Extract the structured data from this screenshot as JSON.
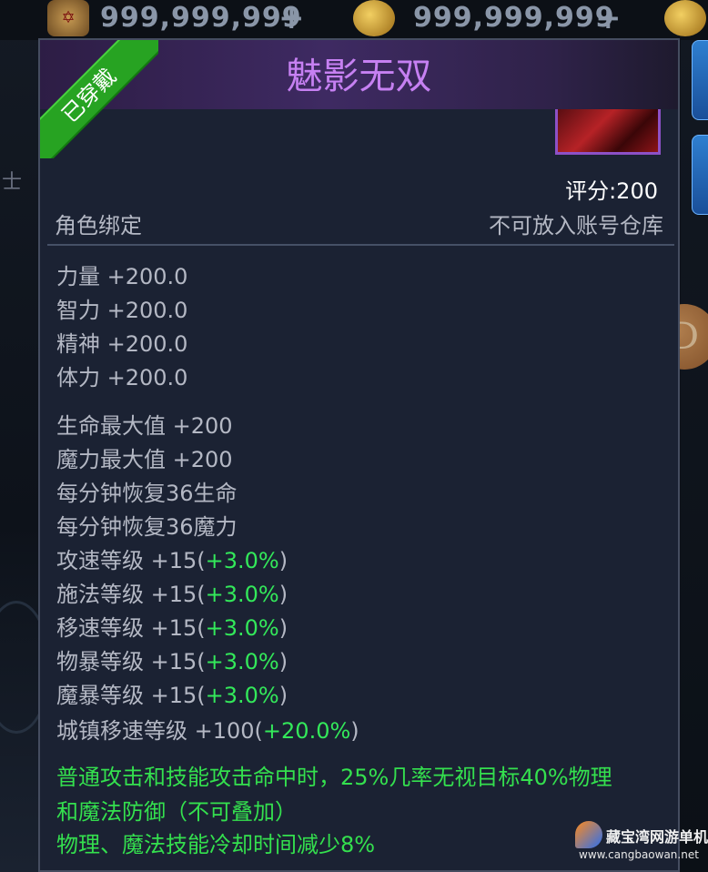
{
  "currency_bar": {
    "items": [
      {
        "icon": "scroll-currency-icon",
        "value": "999,999,999"
      },
      {
        "icon": "gold-coin-icon",
        "value": "999,999,999"
      }
    ],
    "add_symbol": "+"
  },
  "background": {
    "left_glyph": "士",
    "coin_letter": "D"
  },
  "tooltip": {
    "title": "魅影无双",
    "equipped_badge": "已穿戴",
    "score": "评分:200",
    "bind_label": "角色绑定",
    "storage_note": "不可放入账号仓库",
    "base_stats": [
      {
        "text": "力量 +200.0"
      },
      {
        "text": "智力 +200.0"
      },
      {
        "text": "精神 +200.0"
      },
      {
        "text": "体力 +200.0"
      }
    ],
    "extra_stats": [
      {
        "text": "生命最大值 +200",
        "bonus": ""
      },
      {
        "text": "魔力最大值 +200",
        "bonus": ""
      },
      {
        "text": "每分钟恢复36生命",
        "bonus": ""
      },
      {
        "text": "每分钟恢复36魔力",
        "bonus": ""
      },
      {
        "text": "攻速等级 +15(",
        "bonus": "+3.0%",
        "close": ")"
      },
      {
        "text": "施法等级 +15(",
        "bonus": "+3.0%",
        "close": ")"
      },
      {
        "text": "移速等级 +15(",
        "bonus": "+3.0%",
        "close": ")"
      },
      {
        "text": "物暴等级 +15(",
        "bonus": "+3.0%",
        "close": ")"
      },
      {
        "text": "魔暴等级 +15(",
        "bonus": "+3.0%",
        "close": ")"
      },
      {
        "text": "城镇移速等级 +100(",
        "bonus": "+20.0%",
        "close": ")"
      }
    ],
    "special_effects": [
      "普通攻击和技能攻击命中时，25%几率无视目标40%物理",
      "和魔法防御（不可叠加）",
      "物理、魔法技能冷却时间减少8%"
    ]
  },
  "watermark": {
    "name": "藏宝湾网游单机",
    "url": "www.cangbaowan.net"
  },
  "colors": {
    "title": "#c680f2",
    "badge": "#27a322",
    "bonus_green": "#33e85a",
    "effect_green": "#34e04e",
    "stat_text": "#b4b8c4"
  }
}
